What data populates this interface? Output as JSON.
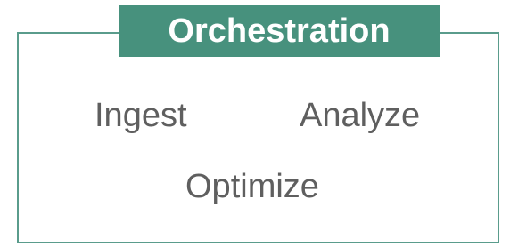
{
  "title": "Orchestration",
  "items": [
    "Ingest",
    "Analyze",
    "Optimize"
  ],
  "colors": {
    "accent": "#47917d",
    "border": "#5a9c8c",
    "text": "#5f5f5f",
    "title_text": "#ffffff"
  }
}
